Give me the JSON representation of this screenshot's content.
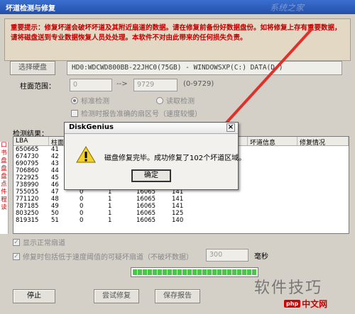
{
  "window": {
    "title": "坏道检测与修复",
    "watermark": "系统之家"
  },
  "warning": {
    "text": "重要提示：修复坏道会破坏坏道及其附近扇道的数据。请在修复前备份好数据盘份。如将修复上存有重要数据，请将磁盘送到专业数据恢复人员处处理。本软件不对由此带来的任何损失负责。"
  },
  "device": {
    "select_label": "选择硬盘",
    "path": "HD0:WDCWD800BB-22JHC0(75GB) - WINDOWSXP(C:) DATA(D:)"
  },
  "range": {
    "label": "柱面范围：",
    "from": "0",
    "arrow": "-->",
    "to": "9729",
    "max": "(0-9729)"
  },
  "modes": {
    "standard": "标准检测",
    "fast": "读取检测"
  },
  "options": {
    "report_accurate": "检测时报告准确的扇区号（速度较慢）"
  },
  "results": {
    "label": "检测结果：",
    "columns": [
      "LBA",
      "柱面",
      "",
      "",
      "",
      "",
      "坏道信息",
      "修复情况"
    ],
    "rows": [
      [
        "650665",
        "41"
      ],
      [
        "674730",
        "42"
      ],
      [
        "690795",
        "43"
      ],
      [
        "706860",
        "44"
      ],
      [
        "722925",
        "45"
      ],
      [
        "738990",
        "46"
      ],
      [
        "755055",
        "47",
        "0",
        "1",
        "16065",
        "141"
      ],
      [
        "771120",
        "48",
        "0",
        "1",
        "16065",
        "141"
      ],
      [
        "787185",
        "49",
        "0",
        "1",
        "16065",
        "141"
      ],
      [
        "803250",
        "50",
        "0",
        "1",
        "16065",
        "125"
      ],
      [
        "819315",
        "51",
        "0",
        "1",
        "16065",
        "140"
      ]
    ],
    "side_labels": [
      "口",
      "书",
      "盘",
      "盘",
      "盘",
      "点",
      "件",
      "程",
      "读"
    ]
  },
  "bottom": {
    "show_normal": "显示正常扇道",
    "auto_skip": "修复时包括低于速度阈值的可疑坏扇道（不破坏数据）",
    "threshold_value": "300",
    "ms_label": "毫秒",
    "progress": 1.0
  },
  "buttons": {
    "stop": "停止",
    "try_repair": "尝试修复",
    "save_report": "保存报告"
  },
  "overlay": {
    "brand_text": "软件技巧",
    "logo_text": "中文网",
    "logo_badge": "php"
  },
  "dialog": {
    "title": "DiskGenius",
    "close": "×",
    "message": "磁盘修复完毕。成功修复了102个坏道区域。",
    "ok": "确定"
  },
  "colors": {
    "title_bar": "#2a58b8",
    "warning_text": "#c00000",
    "progress": "#4ac648",
    "arrow": "#e0302a"
  }
}
